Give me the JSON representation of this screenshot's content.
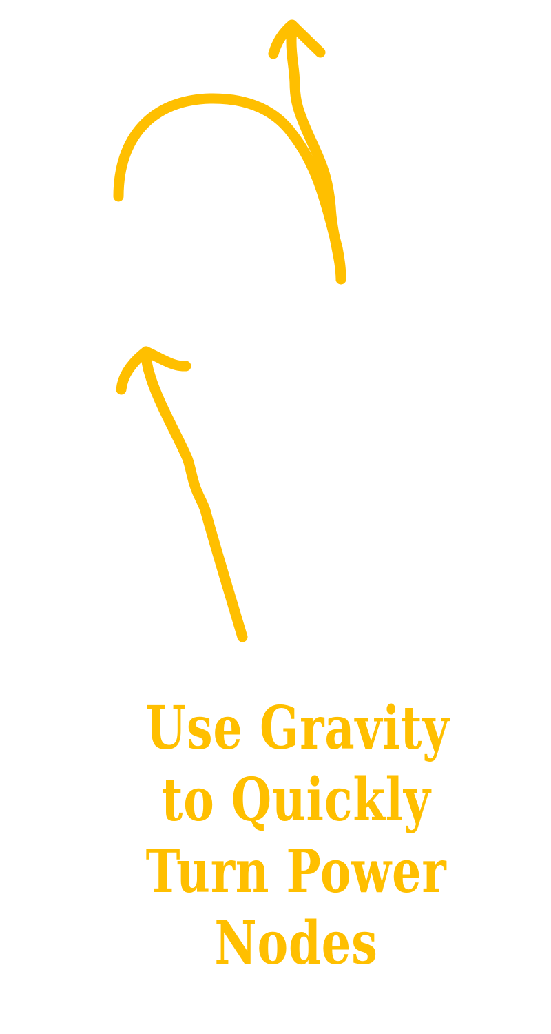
{
  "hint": {
    "lines": [
      "Use Gravity",
      "to Quickly",
      "Turn Power",
      "Nodes"
    ]
  },
  "colors": {
    "accent": "#ffbf00",
    "background": "#ffffff"
  },
  "icons": {
    "upper": "curved-up-arrow-icon",
    "lower": "straight-up-arrow-icon"
  }
}
